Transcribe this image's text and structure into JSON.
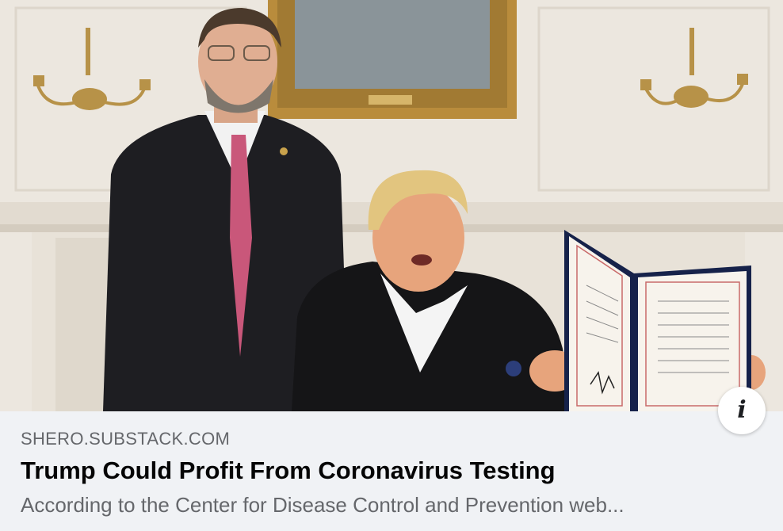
{
  "link_preview": {
    "image_alt": "Two men in a formal room; one seated man holds up a signed document",
    "domain": "SHERO.SUBSTACK.COM",
    "title": "Trump Could Profit From Coronavirus Testing",
    "description": "According to the Center for Disease Control and Prevention web...",
    "info_icon": "info-icon",
    "info_glyph": "i"
  }
}
